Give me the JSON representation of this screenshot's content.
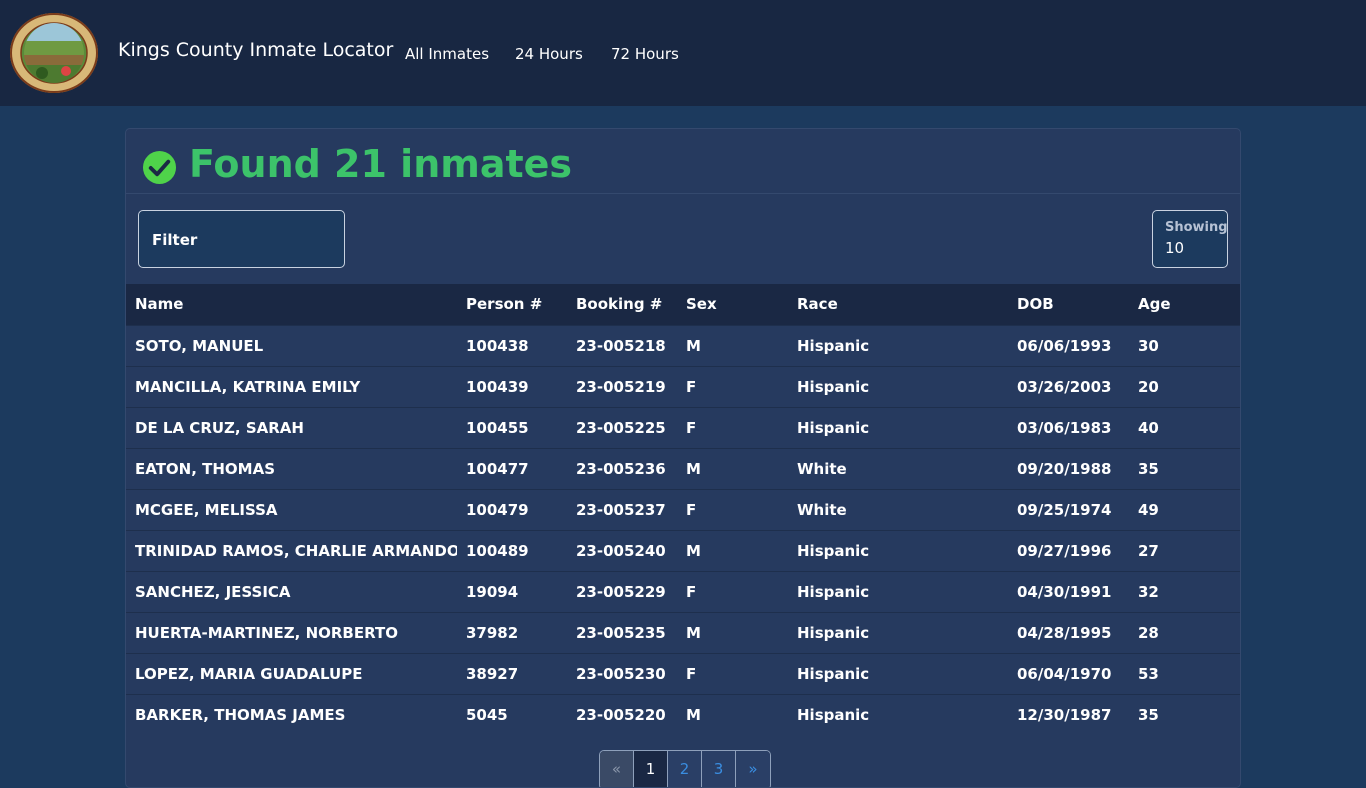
{
  "header": {
    "brand": "Kings County Inmate Locator",
    "nav": [
      "All Inmates",
      "24 Hours",
      "72 Hours"
    ]
  },
  "summary": {
    "title": "Found 21 inmates"
  },
  "filter": {
    "label": "Filter"
  },
  "showing": {
    "label": "Showing",
    "value": "10"
  },
  "table": {
    "columns": [
      "Name",
      "Person #",
      "Booking #",
      "Sex",
      "Race",
      "DOB",
      "Age"
    ],
    "rows": [
      [
        "SOTO, MANUEL",
        "100438",
        "23-005218",
        "M",
        "Hispanic",
        "06/06/1993",
        "30"
      ],
      [
        "MANCILLA, KATRINA EMILY",
        "100439",
        "23-005219",
        "F",
        "Hispanic",
        "03/26/2003",
        "20"
      ],
      [
        "DE LA CRUZ, SARAH",
        "100455",
        "23-005225",
        "F",
        "Hispanic",
        "03/06/1983",
        "40"
      ],
      [
        "EATON, THOMAS",
        "100477",
        "23-005236",
        "M",
        "White",
        "09/20/1988",
        "35"
      ],
      [
        "MCGEE, MELISSA",
        "100479",
        "23-005237",
        "F",
        "White",
        "09/25/1974",
        "49"
      ],
      [
        "TRINIDAD RAMOS, CHARLIE ARMANDO",
        "100489",
        "23-005240",
        "M",
        "Hispanic",
        "09/27/1996",
        "27"
      ],
      [
        "SANCHEZ, JESSICA",
        "19094",
        "23-005229",
        "F",
        "Hispanic",
        "04/30/1991",
        "32"
      ],
      [
        "HUERTA-MARTINEZ, NORBERTO",
        "37982",
        "23-005235",
        "M",
        "Hispanic",
        "04/28/1995",
        "28"
      ],
      [
        "LOPEZ, MARIA GUADALUPE",
        "38927",
        "23-005230",
        "F",
        "Hispanic",
        "06/04/1970",
        "53"
      ],
      [
        "BARKER, THOMAS JAMES",
        "5045",
        "23-005220",
        "M",
        "Hispanic",
        "12/30/1987",
        "35"
      ]
    ]
  },
  "pagination": {
    "pages": [
      "«",
      "1",
      "2",
      "3",
      "»"
    ],
    "active": "1"
  },
  "colors": {
    "success": "#3cc36a",
    "navbar": "#182742",
    "page_bg": "#1c3a5e",
    "card_bg": "#263a5f"
  },
  "icons": {
    "logo": "kings-county-seal",
    "status": "check-circle-icon"
  }
}
